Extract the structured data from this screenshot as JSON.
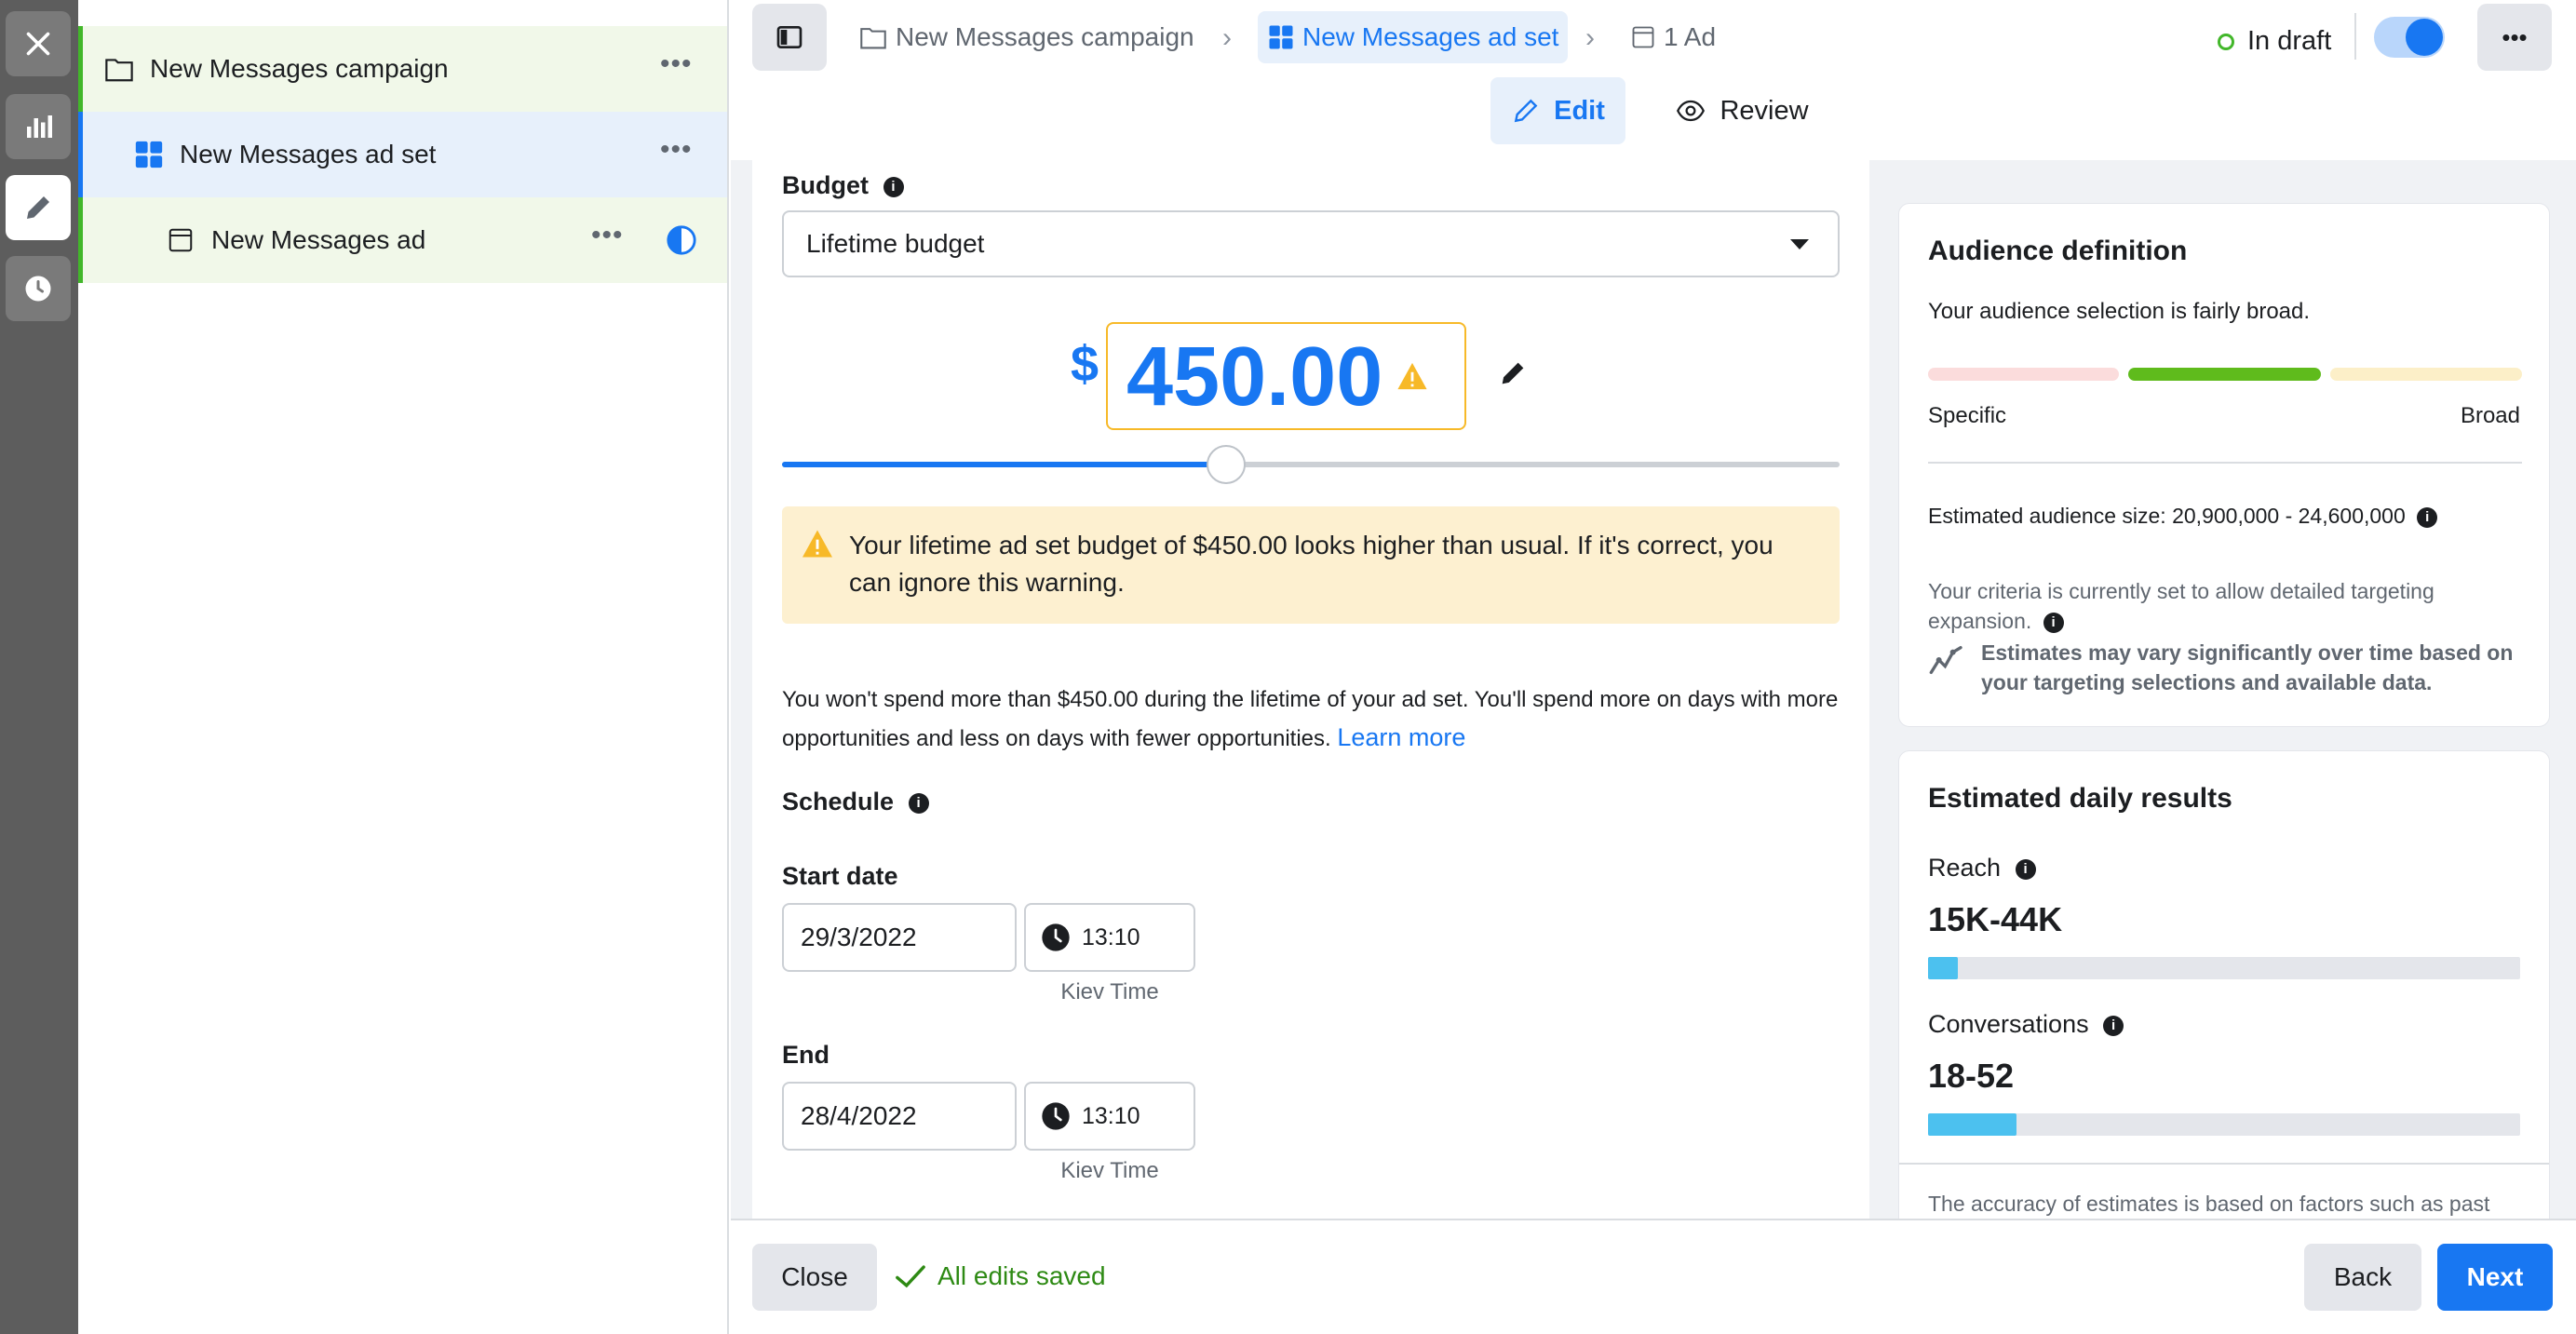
{
  "tree": {
    "campaign": "New Messages campaign",
    "adset": "New Messages ad set",
    "ad": "New Messages ad"
  },
  "breadcrumb": {
    "campaign": "New Messages campaign",
    "adset": "New Messages ad set",
    "ad": "1 Ad"
  },
  "status": {
    "label": "In draft"
  },
  "tabs": {
    "edit": "Edit",
    "review": "Review"
  },
  "budget": {
    "label": "Budget",
    "type": "Lifetime budget",
    "currency": "$",
    "amount": "450.00",
    "slider_fraction": 0.42,
    "warning": "Your lifetime ad set budget of $450.00 looks higher than usual. If it's correct, you can ignore this warning.",
    "note": "You won't spend more than $450.00 during the lifetime of your ad set. You'll spend more on days with more opportunities and less on days with fewer opportunities.",
    "learn_more": "Learn more"
  },
  "schedule": {
    "label": "Schedule",
    "start_label": "Start date",
    "start_date": "29/3/2022",
    "start_time": "13:10",
    "start_tz": "Kiev Time",
    "end_label": "End",
    "end_date": "28/4/2022",
    "end_time": "13:10",
    "end_tz": "Kiev Time"
  },
  "audience": {
    "title": "Audience definition",
    "desc": "Your audience selection is fairly broad.",
    "specific": "Specific",
    "broad": "Broad",
    "size_label": "Estimated audience size:",
    "size_value": "20,900,000 - 24,600,000",
    "criteria": "Your criteria is currently set to allow detailed targeting expansion.",
    "estimates_note": "Estimates may vary significantly over time based on your targeting selections and available data."
  },
  "daily": {
    "title": "Estimated daily results",
    "reach_label": "Reach",
    "reach_value": "15K-44K",
    "reach_fraction": 0.05,
    "conv_label": "Conversations",
    "conv_value": "18-52",
    "conv_fraction": 0.15,
    "accuracy": "The accuracy of estimates is based on factors such as past campaign data, the budget you entered, market data"
  },
  "footer": {
    "close": "Close",
    "saved": "All edits saved",
    "back": "Back",
    "next": "Next"
  },
  "colors": {
    "accent": "#1877f2",
    "warning": "#f7b928",
    "success": "#42b72a",
    "tree_campaign_bg": "#f1f8e9",
    "tree_adset_bg": "#e7f0fb"
  }
}
